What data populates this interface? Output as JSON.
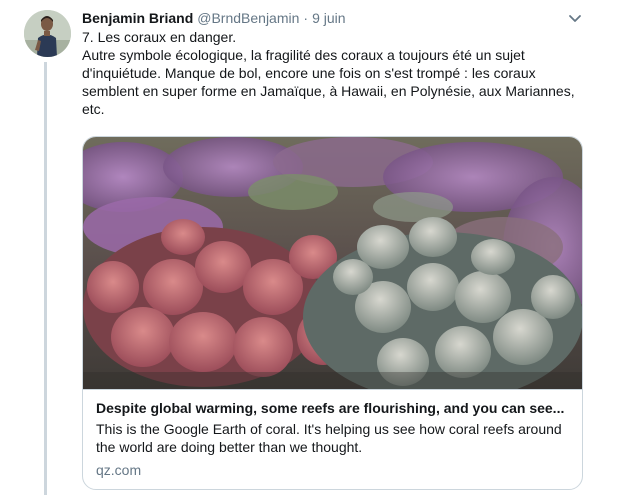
{
  "tweet": {
    "author": {
      "display_name": "Benjamin Briand",
      "handle": "@BrndBenjamin",
      "separator": "·",
      "time": "9 juin"
    },
    "text_lines": [
      "7. Les coraux en danger.",
      "Autre symbole écologique, la fragilité des coraux a toujours été un sujet",
      "d'inquiétude. Manque de bol, encore une fois on s'est trompé : les coraux",
      "semblent en super forme en Jamaïque, à Hawaii, en Polynésie, aux Mariannes,",
      "etc."
    ],
    "icons": {
      "avatar": "user-avatar",
      "menu": "chevron-down-icon"
    }
  },
  "card": {
    "image": "coral-reef-photo",
    "title": "Despite global warming, some reefs are flourishing, and you can see...",
    "description_lines": [
      "This is the Google Earth of coral. It's helping us see how coral reefs around",
      "the world are doing better than we thought."
    ],
    "domain": "qz.com"
  },
  "colors": {
    "text": "#14171a",
    "secondary": "#657786",
    "border": "#ccd6dd",
    "thread_line": "#cdd6dd"
  }
}
